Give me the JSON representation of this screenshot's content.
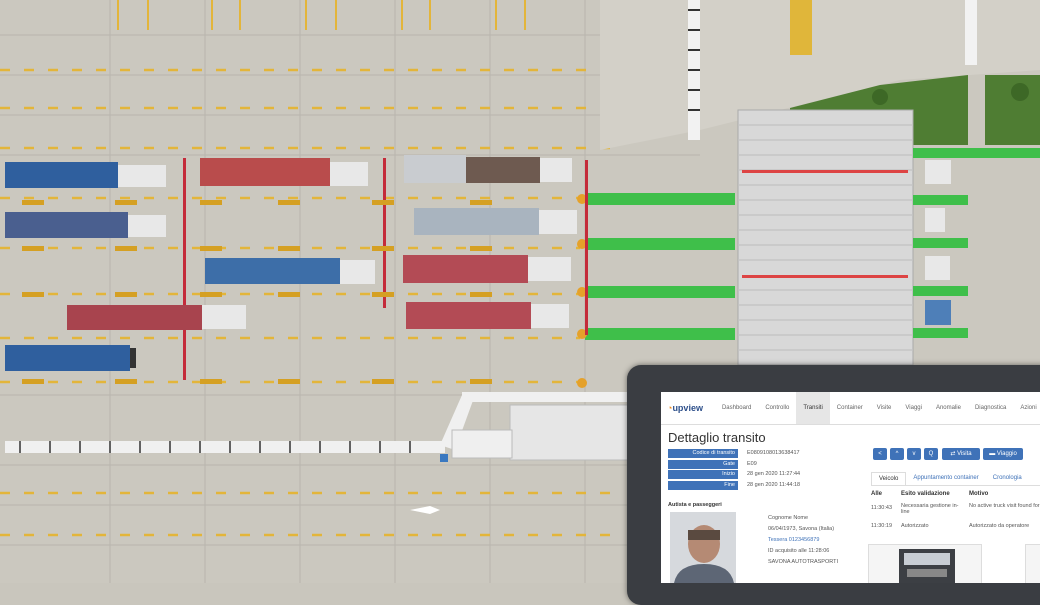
{
  "screen": {
    "logo": "upview",
    "nav": [
      "Dashboard",
      "Controllo",
      "Transiti",
      "Container",
      "Visite",
      "Viaggi",
      "Anomalie",
      "Diagnostica",
      "Azioni"
    ],
    "active_nav": "Transiti",
    "title": "Dettaglio transito",
    "info": [
      {
        "label": "Codice di transito",
        "value": "E0809108013638417"
      },
      {
        "label": "Gate",
        "value": "E09"
      },
      {
        "label": "Inizio",
        "value": "28 gen 2020 11:27:44"
      },
      {
        "label": "Fine",
        "value": "28 gen 2020 11:44:18"
      }
    ],
    "toolbar": {
      "prev": "<",
      "up": "^",
      "down": "v",
      "search": "Q",
      "visit": "Visita",
      "trip": "Viaggio"
    },
    "tabs": [
      "Veicolo",
      "Appuntamento container",
      "Cronologia"
    ],
    "section_label": "Autista e passeggeri",
    "driver": {
      "name_label": "Cognome Nome",
      "born": "06/04/1973, Savona (Italia)",
      "badge": "Tessera 0123456879",
      "acquired": "ID acquisito alle 11:28:06",
      "company": "SAVONA AUTOTRASPORTI"
    },
    "validation_headers": [
      "Alle",
      "Esito validazione",
      "Motivo"
    ],
    "validation_rows": [
      {
        "time": "11:30:43",
        "result": "Necessaria gestione in-line",
        "reason": "No active truck visit found for T"
      },
      {
        "time": "11:30:19",
        "result": "Autorizzato",
        "reason": "Autorizzato da operatore"
      }
    ]
  }
}
